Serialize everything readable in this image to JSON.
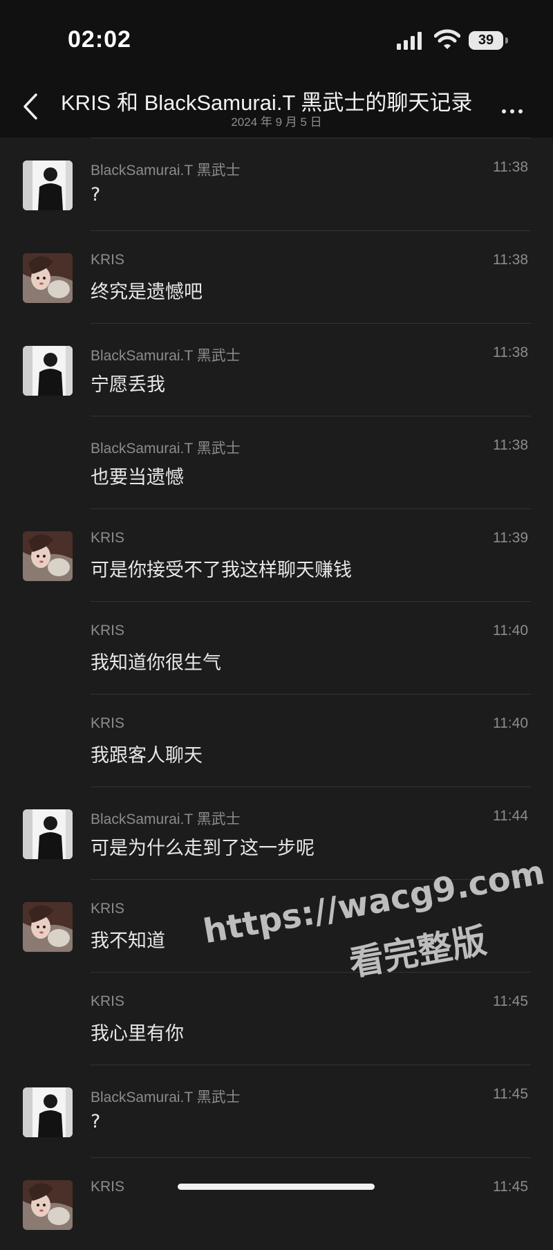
{
  "status_bar": {
    "time": "02:02",
    "battery": "39"
  },
  "header": {
    "title": "KRIS 和 BlackSamurai.T 黑武士的聊天记录",
    "date": "2024 年 9 月 5 日"
  },
  "messages": [
    {
      "sender": "BlackSamurai.T 黑武士",
      "time": "11:38",
      "text": "?",
      "avatar": "black-samurai"
    },
    {
      "sender": "KRIS",
      "time": "11:38",
      "text": "终究是遗憾吧",
      "avatar": "kris"
    },
    {
      "sender": "BlackSamurai.T 黑武士",
      "time": "11:38",
      "text": "宁愿丢我",
      "avatar": "black-samurai"
    },
    {
      "sender": "BlackSamurai.T 黑武士",
      "time": "11:38",
      "text": "也要当遗憾",
      "avatar": "none"
    },
    {
      "sender": "KRIS",
      "time": "11:39",
      "text": "可是你接受不了我这样聊天赚钱",
      "avatar": "kris"
    },
    {
      "sender": "KRIS",
      "time": "11:40",
      "text": "我知道你很生气",
      "avatar": "none"
    },
    {
      "sender": "KRIS",
      "time": "11:40",
      "text": "我跟客人聊天",
      "avatar": "none"
    },
    {
      "sender": "BlackSamurai.T 黑武士",
      "time": "11:44",
      "text": "可是为什么走到了这一步呢",
      "avatar": "black-samurai"
    },
    {
      "sender": "KRIS",
      "time": "",
      "text": "我不知道",
      "avatar": "kris"
    },
    {
      "sender": "KRIS",
      "time": "11:45",
      "text": "我心里有你",
      "avatar": "none"
    },
    {
      "sender": "BlackSamurai.T 黑武士",
      "time": "11:45",
      "text": "?",
      "avatar": "black-samurai"
    },
    {
      "sender": "KRIS",
      "time": "11:45",
      "text": "",
      "avatar": "kris"
    }
  ],
  "watermark": {
    "url": "https://wacg9.com",
    "label": "看完整版"
  },
  "colors": {
    "background": "#1c1c1c",
    "header_background": "#111111",
    "meta_text": "#8c8c8c",
    "message_text": "#e8e8e8"
  }
}
